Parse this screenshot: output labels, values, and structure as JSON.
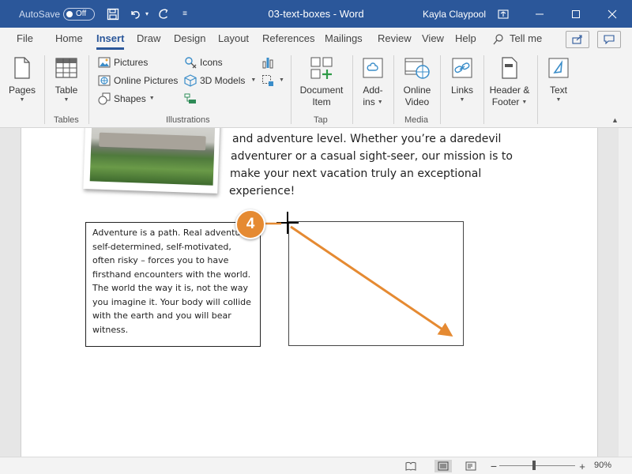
{
  "titlebar": {
    "autosave_label": "AutoSave",
    "autosave_state": "Off",
    "doc_title": "03-text-boxes - Word",
    "user_name": "Kayla Claypool"
  },
  "tabs": [
    {
      "label": "File"
    },
    {
      "label": "Home"
    },
    {
      "label": "Insert",
      "active": true
    },
    {
      "label": "Draw"
    },
    {
      "label": "Design"
    },
    {
      "label": "Layout"
    },
    {
      "label": "References"
    },
    {
      "label": "Mailings"
    },
    {
      "label": "Review"
    },
    {
      "label": "View"
    },
    {
      "label": "Help"
    }
  ],
  "tell_me": "Tell me",
  "ribbon": {
    "pages_label": "Pages",
    "table_label": "Table",
    "tables_group": "Tables",
    "pictures_label": "Pictures",
    "online_pictures_label": "Online Pictures",
    "shapes_label": "Shapes",
    "icons_label": "Icons",
    "models_label": "3D Models",
    "illustrations_group": "Illustrations",
    "document_item_line1": "Document",
    "document_item_line2": "Item",
    "tap_group": "Tap",
    "addins_line1": "Add-",
    "addins_line2": "ins",
    "online_video_line1": "Online",
    "online_video_line2": "Video",
    "media_group": "Media",
    "links_label": "Links",
    "header_footer_line1": "Header &",
    "header_footer_line2": "Footer",
    "text_label": "Text"
  },
  "document": {
    "para_lines": [
      "and adventure level. Whether you’re a daredevil",
      "adventurer or a casual sight-seer, our mission is to",
      "make your next vacation truly an exceptional",
      "experience!"
    ],
    "textbox_lines": [
      "Adventure is a path. Real adventure –",
      "self-determined, self-motivated,",
      "often risky – forces you to have",
      "firsthand encounters with the world.",
      "The world the way it is, not the way",
      "you imagine it. Your body will collide",
      "with the earth and you will bear",
      "witness."
    ]
  },
  "step_badge": "4",
  "statusbar": {
    "zoom": "90%"
  },
  "colors": {
    "titlebar": "#2b579a",
    "accent": "#2b579a",
    "annotation": "#e58a32"
  }
}
